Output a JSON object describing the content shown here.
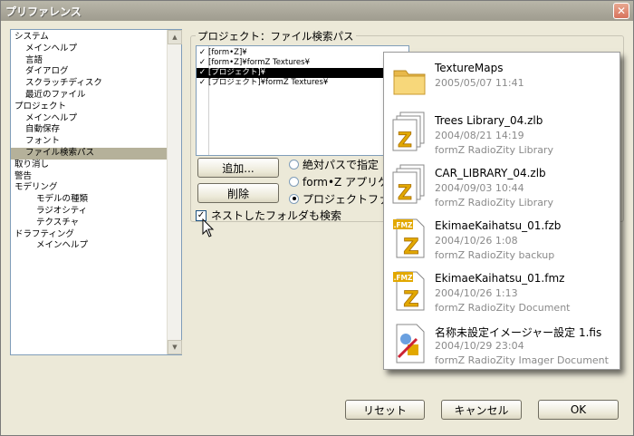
{
  "window": {
    "title": "プリファレンス"
  },
  "tree": {
    "items": [
      {
        "label": "システム",
        "indent": 0
      },
      {
        "label": "メインヘルプ",
        "indent": 1
      },
      {
        "label": "言語",
        "indent": 1
      },
      {
        "label": "ダイアログ",
        "indent": 1
      },
      {
        "label": "スクラッチディスク",
        "indent": 1
      },
      {
        "label": "最近のファイル",
        "indent": 1
      },
      {
        "label": "プロジェクト",
        "indent": 0
      },
      {
        "label": "メインヘルプ",
        "indent": 1
      },
      {
        "label": "自動保存",
        "indent": 1
      },
      {
        "label": "フォント",
        "indent": 1
      },
      {
        "label": "ファイル検索パス",
        "indent": 1,
        "selected": true
      },
      {
        "label": "取り消し",
        "indent": 0
      },
      {
        "label": "警告",
        "indent": 0
      },
      {
        "label": "モデリング",
        "indent": 0
      },
      {
        "label": "モデルの種類",
        "indent": 2
      },
      {
        "label": "ラジオシティ",
        "indent": 2
      },
      {
        "label": "テクスチャ",
        "indent": 2
      },
      {
        "label": "ドラフティング",
        "indent": 0
      },
      {
        "label": "メインヘルプ",
        "indent": 2
      }
    ]
  },
  "group": {
    "label": "プロジェクト：ファイル検索パス"
  },
  "paths": [
    {
      "text": "[form•Z]¥",
      "checked": true,
      "selected": false
    },
    {
      "text": "[form•Z]¥formZ Textures¥",
      "checked": true,
      "selected": false
    },
    {
      "text": "[プロジェクト]¥",
      "checked": true,
      "selected": true
    },
    {
      "text": "[プロジェクト]¥formZ Textures¥",
      "checked": true,
      "selected": false
    }
  ],
  "buttons": {
    "add": "追加...",
    "delete": "削除",
    "reset": "リセット",
    "cancel": "キャンセル",
    "ok": "OK"
  },
  "radios": [
    {
      "label": "絶対パスで指定",
      "checked": false
    },
    {
      "label": "form•Z アプリケ",
      "checked": false
    },
    {
      "label": "プロジェクトファイ",
      "checked": true
    }
  ],
  "nested_search": {
    "label": "ネストしたフォルダも検索",
    "checked": true
  },
  "popup_files": [
    {
      "name": "TextureMaps",
      "date": "2005/05/07 11:41",
      "kind": "",
      "icon": "folder-icon"
    },
    {
      "name": "Trees Library_04.zlb",
      "date": "2004/08/21 14:19",
      "kind": "formZ RadioZity Library",
      "icon": "library-icon"
    },
    {
      "name": "CAR_LIBRARY_04.zlb",
      "date": "2004/09/03 10:44",
      "kind": "formZ RadioZity Library",
      "icon": "library-icon"
    },
    {
      "name": "EkimaeKaihatsu_01.fzb",
      "date": "2004/10/26 1:08",
      "kind": "formZ RadioZity backup",
      "icon": "fmz-icon",
      "badge": ".FMZ"
    },
    {
      "name": "EkimaeKaihatsu_01.fmz",
      "date": "2004/10/26 1:13",
      "kind": "formZ RadioZity Document",
      "icon": "fmz-icon",
      "badge": ".FMZ"
    },
    {
      "name": "名称未設定イメージャー設定 1.fis",
      "date": "2004/10/29 23:04",
      "kind": "formZ RadioZity Imager Document",
      "icon": "imager-icon"
    }
  ]
}
